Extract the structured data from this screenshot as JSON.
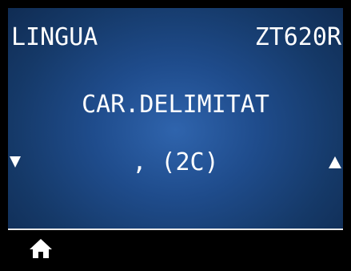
{
  "header": {
    "menu_title": "LINGUA",
    "printer_model": "ZT620R"
  },
  "setting": {
    "name": "CAR.DELIMITAT",
    "value": ", (2C)"
  },
  "navigation": {
    "prev_icon": "triangle-down-icon",
    "next_icon": "triangle-up-icon"
  },
  "footer": {
    "home_icon": "home-icon"
  },
  "colors": {
    "screen_center": "#2f64ad",
    "screen_edge": "#0f2a50",
    "text": "#ffffff",
    "footer_bg": "#000000"
  }
}
